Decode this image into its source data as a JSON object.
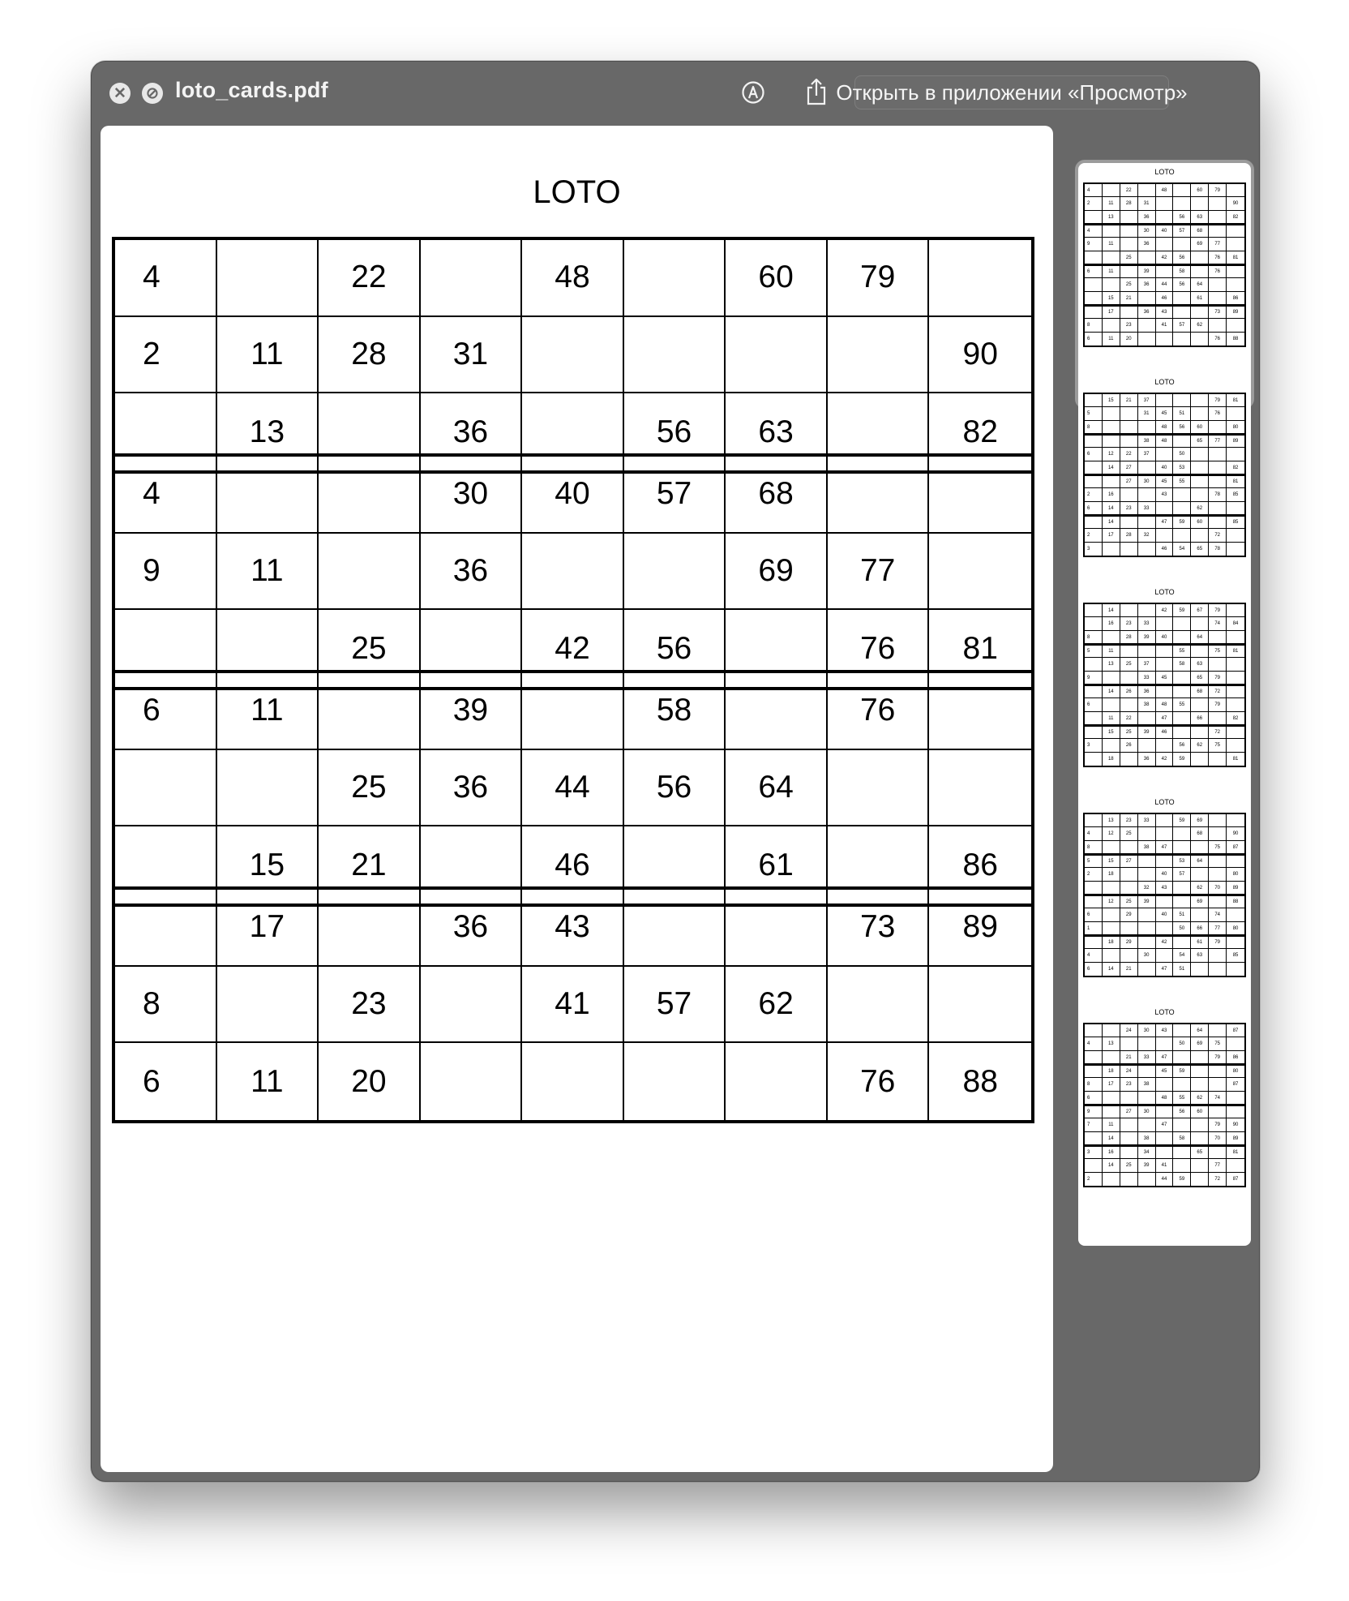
{
  "window": {
    "filename": "loto_cards.pdf",
    "open_button_label": "Открыть в приложении «Просмотр»"
  },
  "icons": {
    "close": "close-icon",
    "block": "block-icon",
    "markup": "markup-icon",
    "share": "share-icon"
  },
  "page": {
    "title": "LOTO",
    "cards": [
      [
        [
          "4",
          "",
          "22",
          "",
          "48",
          "",
          "60",
          "79",
          ""
        ],
        [
          "2",
          "11",
          "28",
          "31",
          "",
          "",
          "",
          "",
          "90"
        ],
        [
          "",
          "13",
          "",
          "36",
          "",
          "56",
          "63",
          "",
          "82"
        ]
      ],
      [
        [
          "4",
          "",
          "",
          "30",
          "40",
          "57",
          "68",
          "",
          ""
        ],
        [
          "9",
          "11",
          "",
          "36",
          "",
          "",
          "69",
          "77",
          ""
        ],
        [
          "",
          "",
          "25",
          "",
          "42",
          "56",
          "",
          "76",
          "81"
        ]
      ],
      [
        [
          "6",
          "11",
          "",
          "39",
          "",
          "58",
          "",
          "76",
          ""
        ],
        [
          "",
          "",
          "25",
          "36",
          "44",
          "56",
          "64",
          "",
          ""
        ],
        [
          "",
          "15",
          "21",
          "",
          "46",
          "",
          "61",
          "",
          "86"
        ]
      ],
      [
        [
          "",
          "17",
          "",
          "36",
          "43",
          "",
          "",
          "73",
          "89"
        ],
        [
          "8",
          "",
          "23",
          "",
          "41",
          "57",
          "62",
          "",
          ""
        ],
        [
          "6",
          "11",
          "20",
          "",
          "",
          "",
          "",
          "76",
          "88"
        ]
      ]
    ]
  },
  "thumbnails": [
    {
      "title": "LOTO",
      "selected": true,
      "cards": [
        [
          [
            "4",
            "",
            "22",
            "",
            "48",
            "",
            "60",
            "79",
            ""
          ],
          [
            "2",
            "11",
            "28",
            "31",
            "",
            "",
            "",
            "",
            "90"
          ],
          [
            "",
            "13",
            "",
            "36",
            "",
            "56",
            "63",
            "",
            "82"
          ]
        ],
        [
          [
            "4",
            "",
            "",
            "30",
            "40",
            "57",
            "68",
            "",
            ""
          ],
          [
            "9",
            "11",
            "",
            "36",
            "",
            "",
            "69",
            "77",
            ""
          ],
          [
            "",
            "",
            "25",
            "",
            "42",
            "56",
            "",
            "76",
            "81"
          ]
        ],
        [
          [
            "6",
            "11",
            "",
            "39",
            "",
            "58",
            "",
            "76",
            ""
          ],
          [
            "",
            "",
            "25",
            "36",
            "44",
            "56",
            "64",
            "",
            ""
          ],
          [
            "",
            "15",
            "21",
            "",
            "46",
            "",
            "61",
            "",
            "86"
          ]
        ],
        [
          [
            "",
            "17",
            "",
            "36",
            "43",
            "",
            "",
            "73",
            "89"
          ],
          [
            "8",
            "",
            "23",
            "",
            "41",
            "57",
            "62",
            "",
            ""
          ],
          [
            "6",
            "11",
            "20",
            "",
            "",
            "",
            "",
            "76",
            "88"
          ]
        ]
      ]
    },
    {
      "title": "LOTO",
      "selected": false,
      "cards": [
        [
          [
            "",
            "15",
            "21",
            "37",
            "",
            "",
            "",
            "79",
            "81"
          ],
          [
            "5",
            "",
            "",
            "31",
            "45",
            "51",
            "",
            "76",
            ""
          ],
          [
            "8",
            "",
            "",
            "",
            "48",
            "56",
            "60",
            "",
            "80"
          ]
        ],
        [
          [
            "",
            "",
            "",
            "38",
            "48",
            "",
            "65",
            "77",
            "89"
          ],
          [
            "6",
            "12",
            "22",
            "37",
            "",
            "50",
            "",
            "",
            ""
          ],
          [
            "",
            "14",
            "27",
            "",
            "40",
            "53",
            "",
            "",
            "82"
          ]
        ],
        [
          [
            "",
            "",
            "27",
            "30",
            "45",
            "55",
            "",
            "",
            "81"
          ],
          [
            "2",
            "16",
            "",
            "",
            "43",
            "",
            "",
            "78",
            "85"
          ],
          [
            "6",
            "14",
            "23",
            "33",
            "",
            "",
            "62",
            "",
            ""
          ]
        ],
        [
          [
            "",
            "14",
            "",
            "",
            "47",
            "59",
            "60",
            "",
            "85"
          ],
          [
            "2",
            "17",
            "28",
            "32",
            "",
            "",
            "",
            "72",
            ""
          ],
          [
            "3",
            "",
            "",
            "",
            "46",
            "54",
            "65",
            "78",
            ""
          ]
        ]
      ]
    },
    {
      "title": "LOTO",
      "selected": false,
      "cards": [
        [
          [
            "",
            "14",
            "",
            "",
            "42",
            "59",
            "67",
            "79",
            ""
          ],
          [
            "",
            "16",
            "23",
            "33",
            "",
            "",
            "",
            "74",
            "84"
          ],
          [
            "8",
            "",
            "28",
            "39",
            "40",
            "",
            "64",
            "",
            ""
          ]
        ],
        [
          [
            "5",
            "11",
            "",
            "",
            "",
            "55",
            "",
            "75",
            "81"
          ],
          [
            "",
            "13",
            "25",
            "37",
            "",
            "58",
            "63",
            "",
            ""
          ],
          [
            "9",
            "",
            "",
            "33",
            "45",
            "",
            "65",
            "79",
            ""
          ]
        ],
        [
          [
            "",
            "14",
            "26",
            "36",
            "",
            "",
            "68",
            "72",
            ""
          ],
          [
            "6",
            "",
            "",
            "38",
            "48",
            "55",
            "",
            "79",
            ""
          ],
          [
            "",
            "11",
            "22",
            "",
            "47",
            "",
            "66",
            "",
            "82"
          ]
        ],
        [
          [
            "",
            "15",
            "25",
            "39",
            "46",
            "",
            "",
            "72",
            ""
          ],
          [
            "3",
            "",
            "26",
            "",
            "",
            "56",
            "62",
            "75",
            ""
          ],
          [
            "",
            "18",
            "",
            "36",
            "42",
            "59",
            "",
            "",
            "81"
          ]
        ]
      ]
    },
    {
      "title": "LOTO",
      "selected": false,
      "cards": [
        [
          [
            "",
            "13",
            "23",
            "33",
            "",
            "59",
            "69",
            "",
            ""
          ],
          [
            "4",
            "12",
            "25",
            "",
            "",
            "",
            "68",
            "",
            "90"
          ],
          [
            "8",
            "",
            "",
            "38",
            "47",
            "",
            "",
            "75",
            "87"
          ]
        ],
        [
          [
            "5",
            "15",
            "27",
            "",
            "",
            "53",
            "64",
            "",
            ""
          ],
          [
            "2",
            "18",
            "",
            "",
            "40",
            "57",
            "",
            "",
            "80"
          ],
          [
            "",
            "",
            "",
            "32",
            "43",
            "",
            "62",
            "70",
            "89"
          ]
        ],
        [
          [
            "",
            "12",
            "25",
            "39",
            "",
            "",
            "69",
            "",
            "88"
          ],
          [
            "6",
            "",
            "29",
            "",
            "40",
            "51",
            "",
            "74",
            ""
          ],
          [
            "1",
            "",
            "",
            "",
            "",
            "50",
            "66",
            "77",
            "80"
          ]
        ],
        [
          [
            "",
            "18",
            "29",
            "",
            "42",
            "",
            "61",
            "79",
            ""
          ],
          [
            "4",
            "",
            "",
            "30",
            "",
            "54",
            "63",
            "",
            "85"
          ],
          [
            "6",
            "14",
            "21",
            "",
            "47",
            "51",
            "",
            "",
            ""
          ]
        ]
      ]
    },
    {
      "title": "LOTO",
      "selected": false,
      "cards": [
        [
          [
            "",
            "",
            "24",
            "30",
            "43",
            "",
            "64",
            "",
            "87"
          ],
          [
            "4",
            "13",
            "",
            "",
            "",
            "50",
            "69",
            "75",
            ""
          ],
          [
            "",
            "",
            "21",
            "33",
            "47",
            "",
            "",
            "79",
            "86"
          ]
        ],
        [
          [
            "",
            "18",
            "24",
            "",
            "45",
            "59",
            "",
            "",
            "80"
          ],
          [
            "8",
            "17",
            "23",
            "38",
            "",
            "",
            "",
            "",
            "87"
          ],
          [
            "6",
            "",
            "",
            "",
            "48",
            "55",
            "62",
            "74",
            ""
          ]
        ],
        [
          [
            "9",
            "",
            "27",
            "30",
            "",
            "56",
            "60",
            "",
            ""
          ],
          [
            "7",
            "11",
            "",
            "",
            "47",
            "",
            "",
            "79",
            "90"
          ],
          [
            "",
            "14",
            "",
            "38",
            "",
            "58",
            "",
            "70",
            "89"
          ]
        ],
        [
          [
            "3",
            "16",
            "",
            "34",
            "",
            "",
            "65",
            "",
            "81"
          ],
          [
            "",
            "14",
            "25",
            "39",
            "41",
            "",
            "",
            "77",
            ""
          ],
          [
            "2",
            "",
            "",
            "",
            "44",
            "59",
            "",
            "72",
            "87"
          ]
        ]
      ]
    }
  ]
}
